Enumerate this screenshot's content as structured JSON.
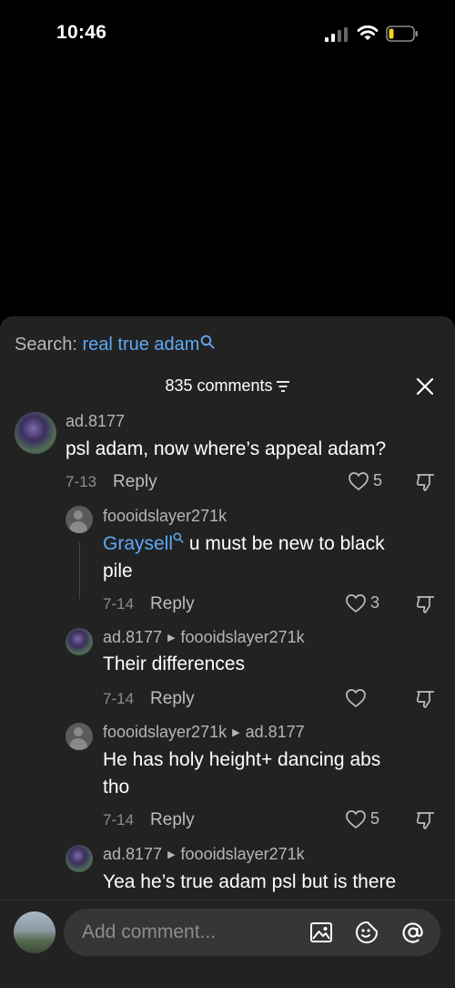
{
  "status_bar": {
    "time": "10:46"
  },
  "comments_panel": {
    "search_prefix": "Search: ",
    "search_term": "real true adam",
    "comment_count": "835 comments"
  },
  "comments": [
    {
      "username": "ad.8177",
      "text": "psl adam, now where’s appeal adam?",
      "date": "7-13",
      "reply_label": "Reply",
      "likes": "5"
    },
    {
      "username": "foooidslayer271k",
      "mention": "Graysell",
      "text_line1": " u must be new to black",
      "text_line2": "pile",
      "date": "7-14",
      "reply_label": "Reply",
      "likes": "3"
    },
    {
      "username": "ad.8177",
      "reply_to": "foooidslayer271k",
      "text": "Their differences",
      "date": "7-14",
      "reply_label": "Reply",
      "likes": ""
    },
    {
      "username": "foooidslayer271k",
      "reply_to": "ad.8177",
      "text_line1": "He has holy height+ dancing abs",
      "text_line2": "tho",
      "date": "7-14",
      "reply_label": "Reply",
      "likes": "5"
    },
    {
      "username": "ad.8177",
      "reply_to": "foooidslayer271k",
      "text": "Yea he’s true adam psl but is there"
    }
  ],
  "composer": {
    "placeholder": "Add comment..."
  },
  "icons": [
    "signal-icon",
    "wifi-icon",
    "battery-icon",
    "search-icon",
    "filter-icon",
    "close-icon",
    "heart-icon",
    "dislike-icon",
    "image-icon",
    "emoji-icon",
    "mention-icon"
  ],
  "colors": {
    "accent": "#5ea9f5",
    "panel": "#222222",
    "battery_low": "#f2d21b"
  }
}
